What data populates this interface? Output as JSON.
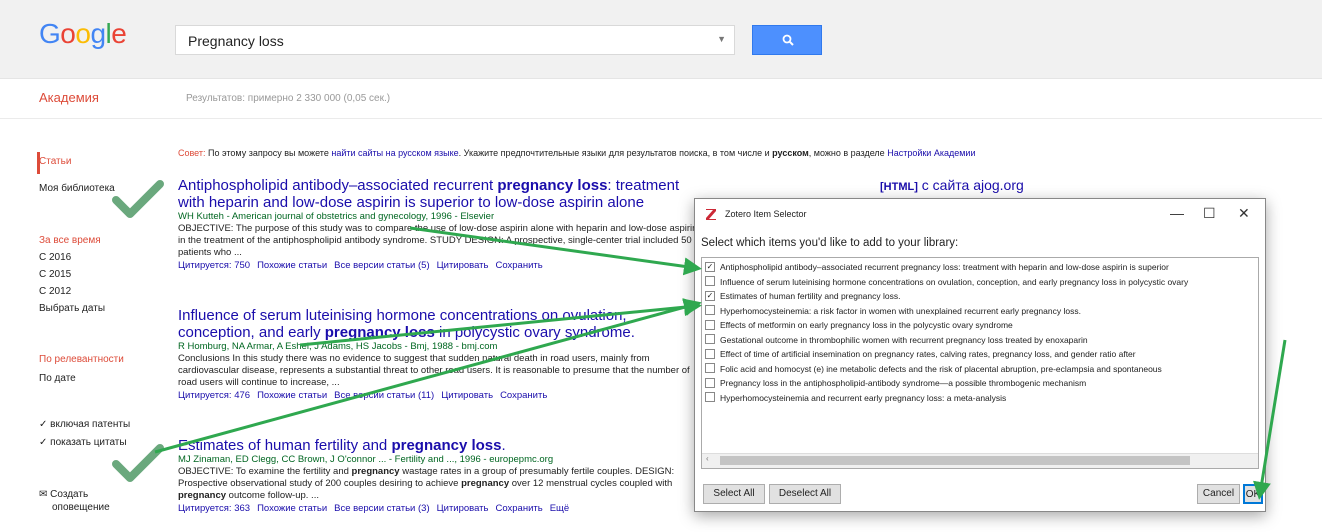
{
  "header": {
    "logo_letters": [
      {
        "ch": "G",
        "color": "#4285f4"
      },
      {
        "ch": "o",
        "color": "#ea4335"
      },
      {
        "ch": "o",
        "color": "#fbbc05"
      },
      {
        "ch": "g",
        "color": "#4285f4"
      },
      {
        "ch": "l",
        "color": "#34a853"
      },
      {
        "ch": "e",
        "color": "#ea4335"
      }
    ],
    "search_value": "Pregnancy loss",
    "search_icon": "search-icon",
    "dropdown_icon": "chevron-down-icon"
  },
  "subbar": {
    "section_title": "Академия",
    "result_stats": "Результатов: примерно 2 330 000 (0,05 сек.)"
  },
  "left_nav": {
    "articles": "Статьи",
    "my_library": "Моя библиотека",
    "any_time": "За все время",
    "since_2016": "С 2016",
    "since_2015": "С 2015",
    "since_2012": "С 2012",
    "pick_dates": "Выбрать даты",
    "by_relevance": "По релевантности",
    "by_date": "По дате",
    "include_patents": "включая патенты",
    "include_citations": "показать цитаты",
    "create_alert_1": "Создать",
    "create_alert_2": "оповещение"
  },
  "spell": {
    "prefix": "Совет:",
    "text1": "По этому запросу вы можете",
    "link1": "найти сайты на русском языке",
    "text2": ". Укажите предпочтительные языки для результатов поиска, в том числе и",
    "bold": "русском",
    "text3": ", можно в разделе",
    "link2": "Настройки Академии"
  },
  "results": [
    {
      "title_pre": "Antiphospholipid antibody–associated recurrent ",
      "title_bold": "pregnancy loss",
      "title_post": ": treatment with heparin and low-dose aspirin is superior to low-dose aspirin alone",
      "html_tag": "[HTML]",
      "html_site": "с сайта ajog.org",
      "authors": "WH Kutteh - American journal of obstetrics and gynecology, 1996 - Elsevier",
      "snippet": "OBJECTIVE: The purpose of this study was to compare the use of low-dose aspirin alone with heparin and low-dose aspirin in the treatment of the antiphospholipid antibody syndrome. STUDY DESIGN: A prospective, single-center trial included 50 patients who ...",
      "links": [
        "Цитируется: 750",
        "Похожие статьи",
        "Все версии статьи (5)",
        "Цитировать",
        "Сохранить"
      ]
    },
    {
      "title_pre": "Influence of serum luteinising hormone concentrations on ovulation, conception, and early ",
      "title_bold": "pregnancy loss",
      "title_post": " in polycystic ovary syndrome.",
      "authors": "R Homburg, NA Armar, A Eshel, J Adams, HS Jacobs - Bmj, 1988 - bmj.com",
      "snippet": "Conclusions In this study there was no evidence to suggest that sudden natural death in road users, mainly from cardiovascular disease, represents a substantial threat to other road users. It is reasonable to presume that the number of road users will continue to increase, ...",
      "links": [
        "Цитируется: 476",
        "Похожие статьи",
        "Все версии статьи (11)",
        "Цитировать",
        "Сохранить"
      ]
    },
    {
      "title_pre": "Estimates of human fertility and ",
      "title_bold": "pregnancy loss",
      "title_post": ".",
      "authors": "MJ Zinaman, ED Clegg, CC Brown, J O'connor ... - Fertility and ..., 1996 - europepmc.org",
      "snippet_pre": "OBJECTIVE: To examine the fertility and ",
      "snippet_b1": "pregnancy",
      "snippet_mid": " wastage rates in a group of presumably fertile couples. DESIGN: Prospective observational study of 200 couples desiring to achieve ",
      "snippet_b2": "pregnancy",
      "snippet_mid2": " over 12 menstrual cycles coupled with ",
      "snippet_b3": "pregnancy",
      "snippet_post": " outcome follow-up. ...",
      "links": [
        "Цитируется: 363",
        "Похожие статьи",
        "Все версии статьи (3)",
        "Цитировать",
        "Сохранить",
        "Ещё"
      ]
    }
  ],
  "dialog": {
    "title": "Zotero Item Selector",
    "prompt": "Select which items you'd like to add to your library:",
    "minimize": "—",
    "maximize": "☐",
    "close": "✕",
    "items": [
      {
        "label": "Antiphospholipid antibody–associated recurrent pregnancy loss: treatment with heparin and low-dose aspirin is superior",
        "checked": true
      },
      {
        "label": "Influence of serum luteinising hormone concentrations on ovulation, conception, and early pregnancy loss in polycystic ovary",
        "checked": false
      },
      {
        "label": "Estimates of human fertility and pregnancy loss.",
        "checked": true
      },
      {
        "label": "Hyperhomocysteinemia: a risk factor in women with unexplained recurrent early pregnancy loss.",
        "checked": false
      },
      {
        "label": "Effects of metformin on early pregnancy loss in the polycystic ovary syndrome",
        "checked": false
      },
      {
        "label": "Gestational outcome in thrombophilic women with recurrent pregnancy loss treated by enoxaparin",
        "checked": false
      },
      {
        "label": "Effect of time of artificial insemination on pregnancy rates, calving rates, pregnancy loss, and gender ratio after",
        "checked": false
      },
      {
        "label": "Folic acid and homocyst (e) ine metabolic defects and the risk of placental abruption, pre-eclampsia and spontaneous",
        "checked": false
      },
      {
        "label": "Pregnancy loss in the antiphospholipid-antibody syndrome—a possible thrombogenic mechanism",
        "checked": false
      },
      {
        "label": "Hyperhomocysteinemia and recurrent early pregnancy loss: a meta-analysis",
        "checked": false
      }
    ],
    "select_all": "Select All",
    "deselect_all": "Deselect All",
    "cancel": "Cancel",
    "ok": "OK"
  },
  "colors": {
    "arrow": "#2fa84f",
    "check": "#5a9e6f",
    "accent_red": "#dd4b39",
    "link": "#1a0dab"
  }
}
